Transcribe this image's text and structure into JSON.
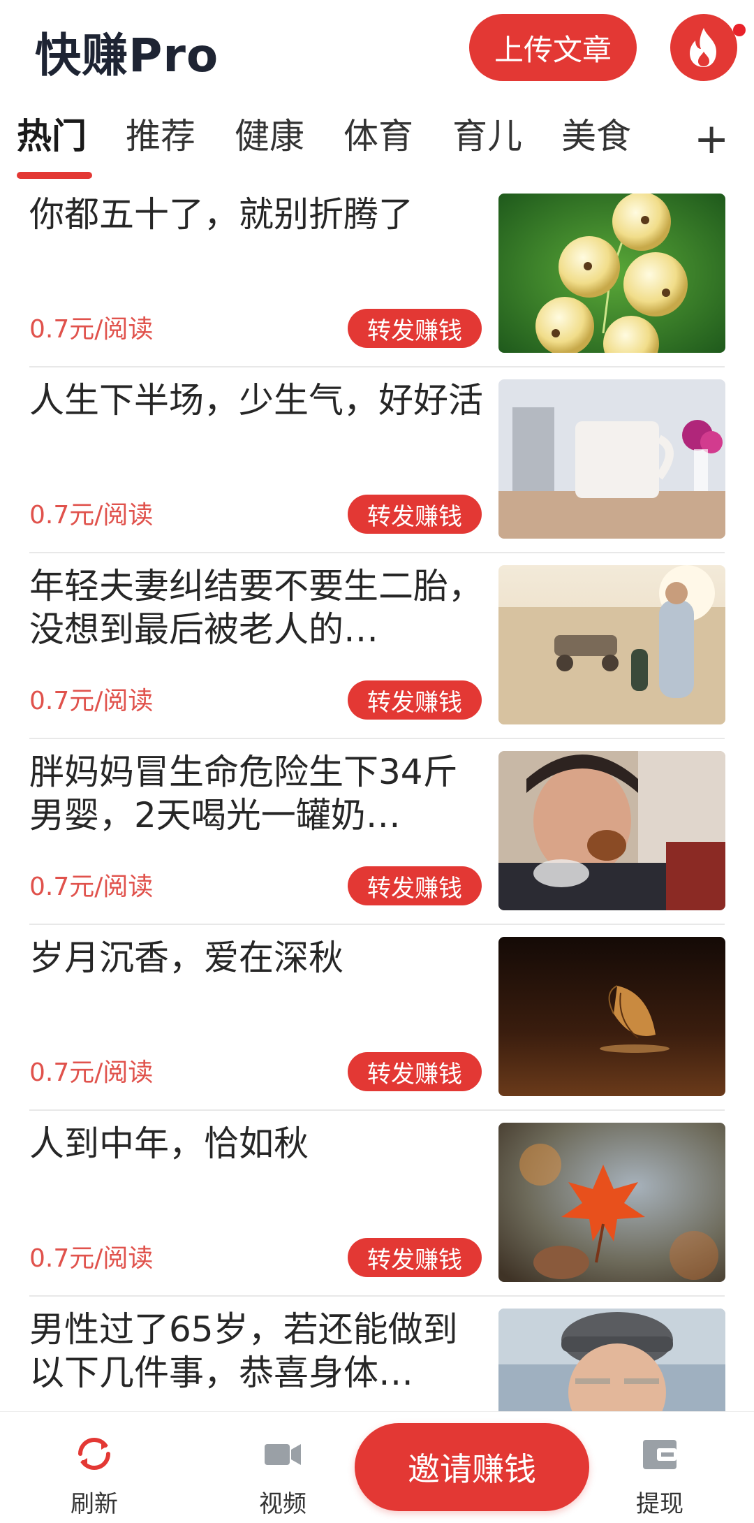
{
  "header": {
    "app_title": "快赚Pro",
    "upload_label": "上传文章",
    "accent_color": "#e33834",
    "fire_icon": "fire-icon",
    "notification_dot": true
  },
  "tabs": {
    "items": [
      {
        "label": "热门",
        "active": true
      },
      {
        "label": "推荐",
        "active": false
      },
      {
        "label": "健康",
        "active": false
      },
      {
        "label": "体育",
        "active": false
      },
      {
        "label": "育儿",
        "active": false
      },
      {
        "label": "美食",
        "active": false
      }
    ],
    "add_label": "+"
  },
  "articles": [
    {
      "title": "你都五十了，就别折腾了",
      "price": "0.7元/阅读",
      "share_label": "转发赚钱",
      "thumb": "currant-berries-image"
    },
    {
      "title": "人生下半场，少生气，好好活",
      "price": "0.7元/阅读",
      "share_label": "转发赚钱",
      "thumb": "coffee-mug-image"
    },
    {
      "title": "年轻夫妻纠结要不要生二胎，没想到最后被老人的…",
      "price": "0.7元/阅读",
      "share_label": "转发赚钱",
      "thumb": "beach-family-image"
    },
    {
      "title": "胖妈妈冒生命危险生下34斤男婴，2天喝光一罐奶…",
      "price": "0.7元/阅读",
      "share_label": "转发赚钱",
      "thumb": "woman-eating-image"
    },
    {
      "title": "岁月沉香，爱在深秋",
      "price": "0.7元/阅读",
      "share_label": "转发赚钱",
      "thumb": "autumn-leaf-dark-image"
    },
    {
      "title": "人到中年，恰如秋",
      "price": "0.7元/阅读",
      "share_label": "转发赚钱",
      "thumb": "maple-leaf-image"
    },
    {
      "title": "男性过了65岁，若还能做到以下几件事，恭喜身体…",
      "price": "",
      "share_label": "",
      "thumb": "elderly-man-image"
    }
  ],
  "bottom_nav": {
    "refresh_label": "刷新",
    "video_label": "视频",
    "invite_label": "邀请赚钱",
    "withdraw_label": "提现"
  }
}
